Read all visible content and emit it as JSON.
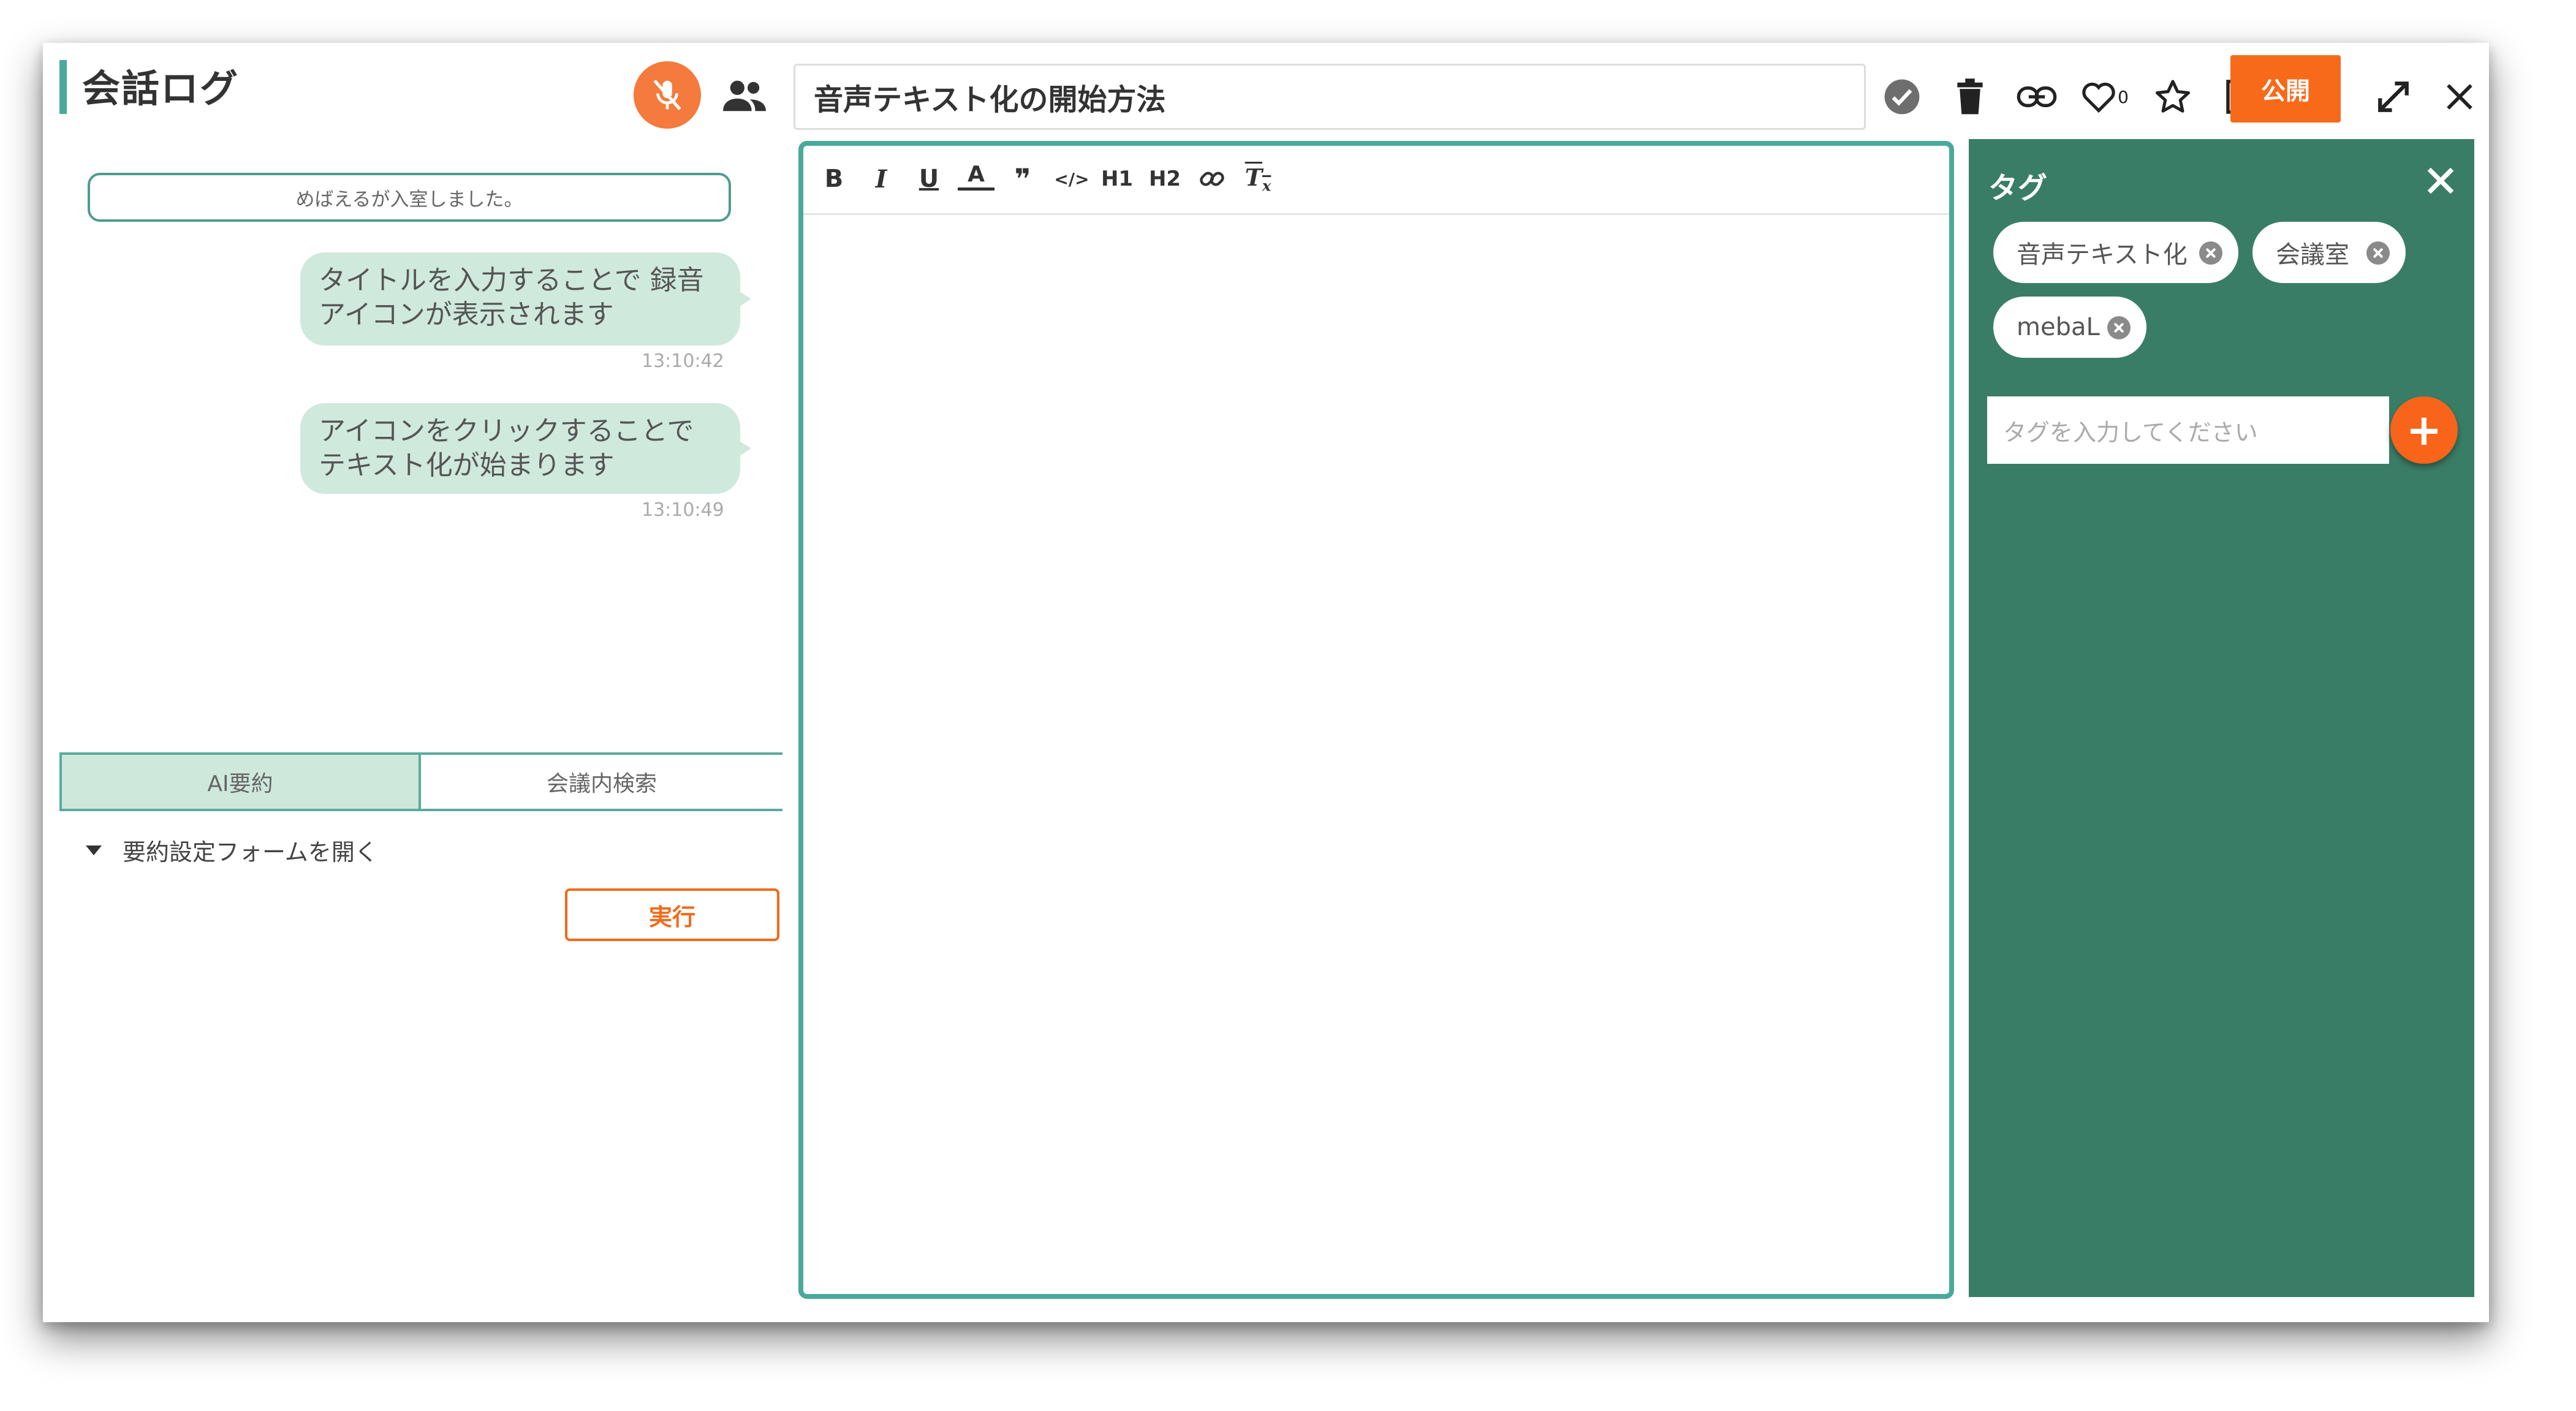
{
  "left_panel": {
    "title": "会話ログ",
    "system_notice": "めばえるが入室しました。",
    "messages": [
      {
        "text_line1": "タイトルを入力することで 録音",
        "text_line2": "アイコンが表示されます",
        "time": "13:10:42"
      },
      {
        "text_line1": "アイコンをクリックすることで",
        "text_line2": "テキスト化が始まります",
        "time": "13:10:49"
      }
    ],
    "tabs": [
      {
        "label": "AI要約",
        "active": true
      },
      {
        "label": "会議内検索",
        "active": false
      }
    ],
    "summary_toggle_label": "要約設定フォームを開く",
    "run_button_label": "実行"
  },
  "header": {
    "title_value": "音声テキスト化の開始方法",
    "like_count": "0",
    "publish_label": "公開",
    "icons": [
      "check-circle-icon",
      "trash-icon",
      "link-icon",
      "heart-icon",
      "star-icon",
      "copy-document-icon",
      "expand-icon",
      "close-icon"
    ]
  },
  "editor": {
    "toolbar": [
      {
        "name": "bold",
        "glyph": "B"
      },
      {
        "name": "italic",
        "glyph": "I"
      },
      {
        "name": "underline",
        "glyph": "U"
      },
      {
        "name": "font-color",
        "glyph": "A"
      },
      {
        "name": "blockquote",
        "glyph": "❞"
      },
      {
        "name": "code",
        "glyph": "</>"
      },
      {
        "name": "heading1",
        "glyph": "H1"
      },
      {
        "name": "heading2",
        "glyph": "H2"
      },
      {
        "name": "link",
        "glyph": "link"
      },
      {
        "name": "clear-format",
        "glyph": "Tx"
      }
    ],
    "content": ""
  },
  "tag_panel": {
    "title": "タグ",
    "tags": [
      "音声テキスト化",
      "会議室",
      "mebaL"
    ],
    "input_placeholder": "タグを入力してください",
    "add_label": "+"
  },
  "colors": {
    "accent_teal": "#4aa99a",
    "tag_panel_bg": "#3a7d66",
    "orange": "#f76a1a",
    "bubble": "#cfe9dd"
  }
}
